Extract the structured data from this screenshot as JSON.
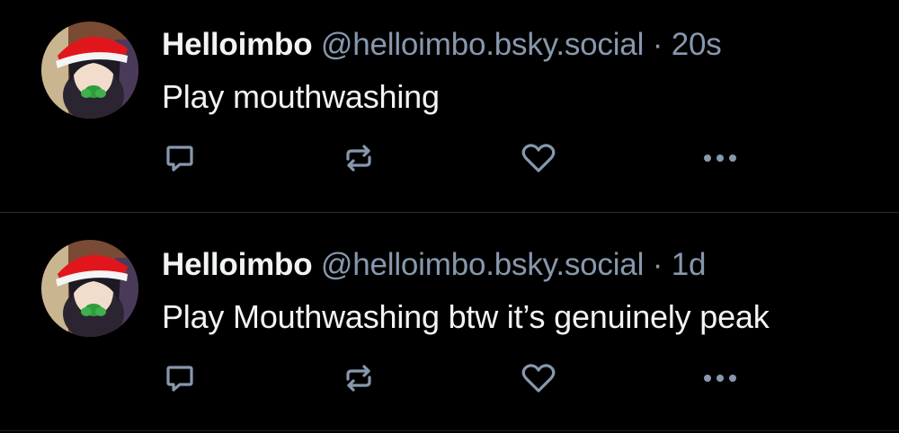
{
  "posts": [
    {
      "author_name": "Helloimbo",
      "handle": "@helloimbo.bsky.social",
      "separator": "·",
      "time": "20s",
      "text": "Play mouthwashing"
    },
    {
      "author_name": "Helloimbo",
      "handle": "@helloimbo.bsky.social",
      "separator": "·",
      "time": "1d",
      "text": "Play Mouthwashing btw it’s genuinely peak"
    }
  ],
  "actions": [
    "reply-icon",
    "repost-icon",
    "like-icon",
    "more-icon"
  ],
  "colors": {
    "background": "#000000",
    "text": "#f1f3f5",
    "muted": "#8798ad",
    "divider": "#262c33",
    "hat_red": "#e0161c"
  }
}
